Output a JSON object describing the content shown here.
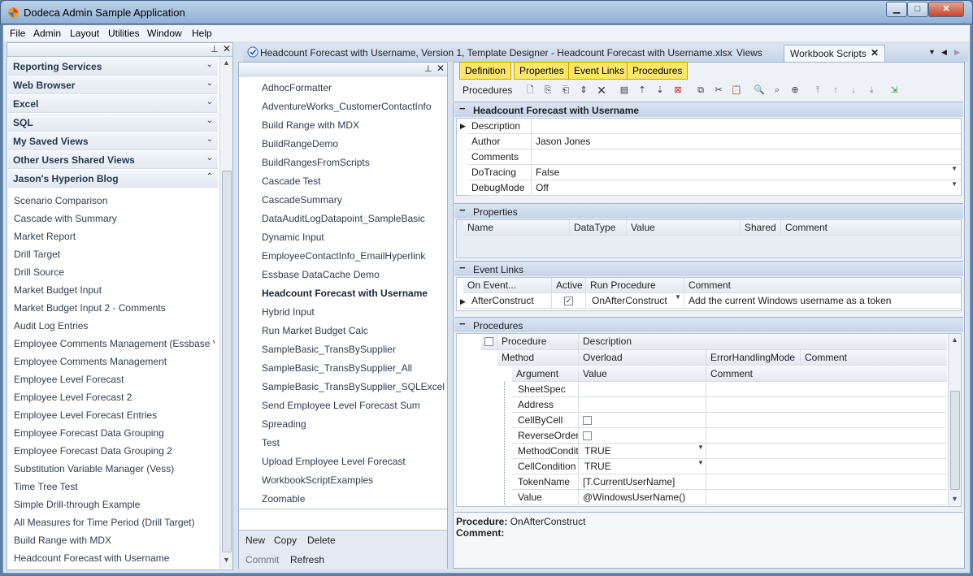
{
  "window": {
    "title": "Dodeca Admin Sample Application",
    "controls": {
      "min": "▁",
      "max": "□",
      "close": "✕"
    }
  },
  "menu": [
    "File",
    "Admin",
    "Layout",
    "Utilities",
    "Window",
    "Help"
  ],
  "sidebar": {
    "groups": [
      {
        "label": "Reporting Services",
        "chev": "⌄"
      },
      {
        "label": "Web Browser",
        "chev": "⌄"
      },
      {
        "label": "Excel",
        "chev": "⌄"
      },
      {
        "label": "SQL",
        "chev": "⌄"
      },
      {
        "label": "My Saved Views",
        "chev": "⌄"
      },
      {
        "label": "Other Users Shared Views",
        "chev": "⌄"
      },
      {
        "label": "Jason's Hyperion Blog",
        "chev": "⌃"
      }
    ],
    "items": [
      "Scenario Comparison",
      "Cascade with Summary",
      "Market Report",
      "Drill Target",
      "Drill Source",
      "Market Budget Input",
      "Market Budget Input 2 - Comments",
      "Audit Log Entries",
      "Employee Comments  Management (Essbase V...",
      "Employee Comments Management",
      "Employee Level Forecast",
      "Employee Level Forecast 2",
      "Employee Level Forecast Entries",
      "Employee Forecast Data Grouping",
      "Employee Forecast Data Grouping 2",
      "Substitution Variable Manager (Vess)",
      "Time Tree Test",
      "Simple Drill-through Example",
      "All Measures for Time Period (Drill Target)",
      "Build Range with MDX",
      "Headcount Forecast with Username"
    ]
  },
  "templates": {
    "items": [
      "AdhocFormatter",
      "AdventureWorks_CustomerContactInfo",
      "Build Range with MDX",
      "BuildRangeDemo",
      "BuildRangesFromScripts",
      "Cascade Test",
      "CascadeSummary",
      "DataAuditLogDatapoint_SampleBasic",
      "Dynamic Input",
      "EmployeeContactInfo_EmailHyperlink",
      "Essbase DataCache Demo",
      "Headcount Forecast with Username",
      "Hybrid Input",
      "Run Market Budget Calc",
      "SampleBasic_TransBySupplier",
      "SampleBasic_TransBySupplier_All",
      "SampleBasic_TransBySupplier_SQLExcel",
      "Send Employee Level Forecast Sum",
      "Spreading",
      "Test",
      "Upload Employee Level Forecast",
      "WorkbookScriptExamples",
      "Zoomable"
    ],
    "actions": {
      "new": "New",
      "copy": "Copy",
      "delete": "Delete",
      "commit": "Commit",
      "refresh": "Refresh"
    }
  },
  "document": {
    "title": "Headcount Forecast with Username, Version 1, Template Designer - Headcount Forecast with Username.xlsx",
    "tabs": {
      "views": "Views",
      "scripts": "Workbook Scripts"
    },
    "nav": {
      "dropdown": "▼",
      "prev": "◀",
      "next": "▶"
    }
  },
  "editor": {
    "tabs": [
      "Definition",
      "Properties",
      "Event Links",
      "Procedures"
    ],
    "toolbar_label": "Procedures",
    "header": {
      "collapse": "−",
      "title": "Headcount Forecast with Username"
    },
    "fields": [
      {
        "name": "Description",
        "value": ""
      },
      {
        "name": "Author",
        "value": "Jason Jones"
      },
      {
        "name": "Comments",
        "value": ""
      },
      {
        "name": "DoTracing",
        "value": "False"
      },
      {
        "name": "DebugMode",
        "value": "Off"
      }
    ],
    "properties": {
      "title": "Properties",
      "columns": [
        "Name",
        "DataType",
        "Value",
        "Shared",
        "Comment"
      ]
    },
    "event_links": {
      "title": "Event Links",
      "columns": [
        "On Event...",
        "Active",
        "Run Procedure",
        "Comment"
      ],
      "rows": [
        {
          "event": "AfterConstruct",
          "active": "✓",
          "procedure": "OnAfterConstruct",
          "comment": "Add the current Windows username as a token"
        }
      ]
    },
    "procedures": {
      "title": "Procedures",
      "columns": [
        "Procedure",
        "Description"
      ],
      "method_columns": [
        "Method",
        "Overload",
        "ErrorHandlingMode",
        "Comment"
      ],
      "arg_columns": [
        "Argument",
        "Value",
        "Comment"
      ],
      "args": [
        {
          "name": "SheetSpec",
          "value": ""
        },
        {
          "name": "Address",
          "value": ""
        },
        {
          "name": "CellByCell",
          "value": "",
          "check": true
        },
        {
          "name": "ReverseOrder",
          "value": "",
          "check": true
        },
        {
          "name": "MethodCondit",
          "value": "TRUE",
          "dd": true
        },
        {
          "name": "CellCondition",
          "value": "TRUE",
          "dd": true
        },
        {
          "name": "TokenName",
          "value": "[T.CurrentUserName]"
        },
        {
          "name": "Value",
          "value": "@WindowsUserName()"
        }
      ]
    },
    "footer": {
      "proc_label": "Procedure",
      "proc_value": "OnAfterConstruct",
      "comment_label": "Comment"
    }
  }
}
